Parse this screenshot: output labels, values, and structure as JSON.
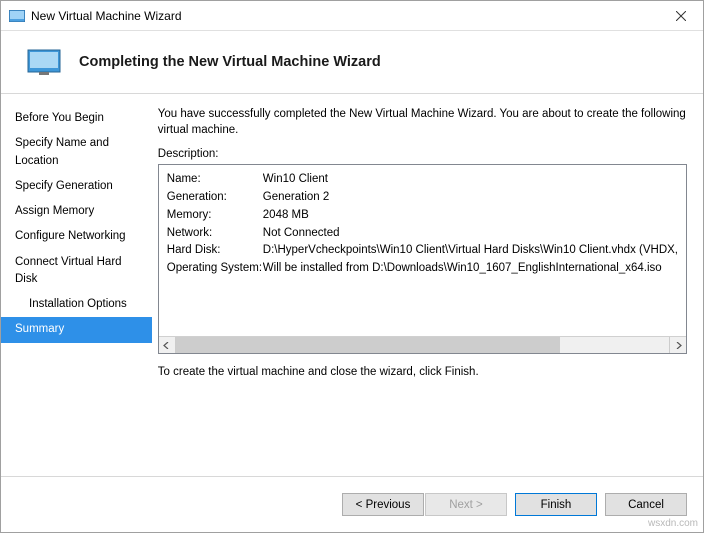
{
  "window": {
    "title": "New Virtual Machine Wizard"
  },
  "header": {
    "title": "Completing the New Virtual Machine Wizard"
  },
  "sidebar": {
    "items": [
      {
        "label": "Before You Begin",
        "indent": false,
        "selected": false
      },
      {
        "label": "Specify Name and Location",
        "indent": false,
        "selected": false
      },
      {
        "label": "Specify Generation",
        "indent": false,
        "selected": false
      },
      {
        "label": "Assign Memory",
        "indent": false,
        "selected": false
      },
      {
        "label": "Configure Networking",
        "indent": false,
        "selected": false
      },
      {
        "label": "Connect Virtual Hard Disk",
        "indent": false,
        "selected": false
      },
      {
        "label": "Installation Options",
        "indent": true,
        "selected": false
      },
      {
        "label": "Summary",
        "indent": false,
        "selected": true
      }
    ]
  },
  "main": {
    "intro": "You have successfully completed the New Virtual Machine Wizard. You are about to create the following virtual machine.",
    "description_label": "Description:",
    "rows": [
      {
        "key": "Name:",
        "value": "Win10 Client"
      },
      {
        "key": "Generation:",
        "value": "Generation 2"
      },
      {
        "key": "Memory:",
        "value": "2048 MB"
      },
      {
        "key": "Network:",
        "value": "Not Connected"
      },
      {
        "key": "Hard Disk:",
        "value": "D:\\HyperVcheckpoints\\Win10 Client\\Virtual Hard Disks\\Win10 Client.vhdx (VHDX,"
      },
      {
        "key": "Operating System:",
        "value": "Will be installed from D:\\Downloads\\Win10_1607_EnglishInternational_x64.iso"
      }
    ],
    "note": "To create the virtual machine and close the wizard, click Finish."
  },
  "footer": {
    "previous": "< Previous",
    "next": "Next >",
    "finish": "Finish",
    "cancel": "Cancel"
  },
  "watermark": "wsxdn.com"
}
